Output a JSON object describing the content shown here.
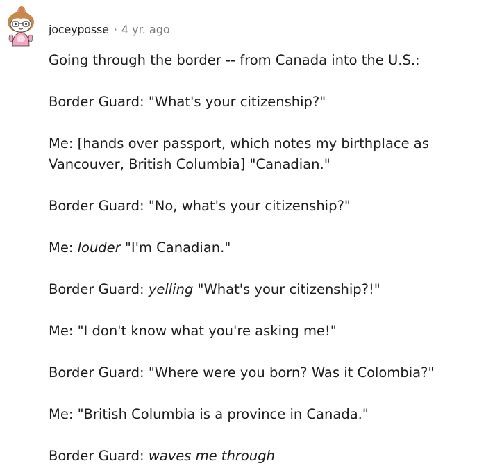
{
  "comment": {
    "author": "joceyposse",
    "separator": "·",
    "timestamp": "4 yr. ago",
    "avatar_icon": "snoo-avatar-icon",
    "paragraphs": [
      {
        "pre": "Going through the border -- from Canada into the U.S.:",
        "em": "",
        "post": ""
      },
      {
        "pre": "Border Guard: \"What's your citizenship?\"",
        "em": "",
        "post": ""
      },
      {
        "pre": "Me: [hands over passport, which notes my birthplace as Vancouver, British Columbia] \"Canadian.\"",
        "em": "",
        "post": ""
      },
      {
        "pre": "Border Guard: \"No, what's your citizenship?\"",
        "em": "",
        "post": ""
      },
      {
        "pre": "Me: ",
        "em": "louder",
        "post": " \"I'm Canadian.\""
      },
      {
        "pre": "Border Guard: ",
        "em": "yelling",
        "post": " \"What's your citizenship?!\""
      },
      {
        "pre": "Me: \"I don't know what you're asking me!\"",
        "em": "",
        "post": ""
      },
      {
        "pre": "Border Guard: \"Where were you born? Was it Colombia?\"",
        "em": "",
        "post": ""
      },
      {
        "pre": "Me: \"British Columbia is a province in Canada.\"",
        "em": "",
        "post": ""
      },
      {
        "pre": "Border Guard: ",
        "em": "waves me through",
        "post": ""
      }
    ]
  },
  "colors": {
    "text": "#1c1c1c",
    "meta": "#7c7c7c",
    "background": "#ffffff"
  }
}
